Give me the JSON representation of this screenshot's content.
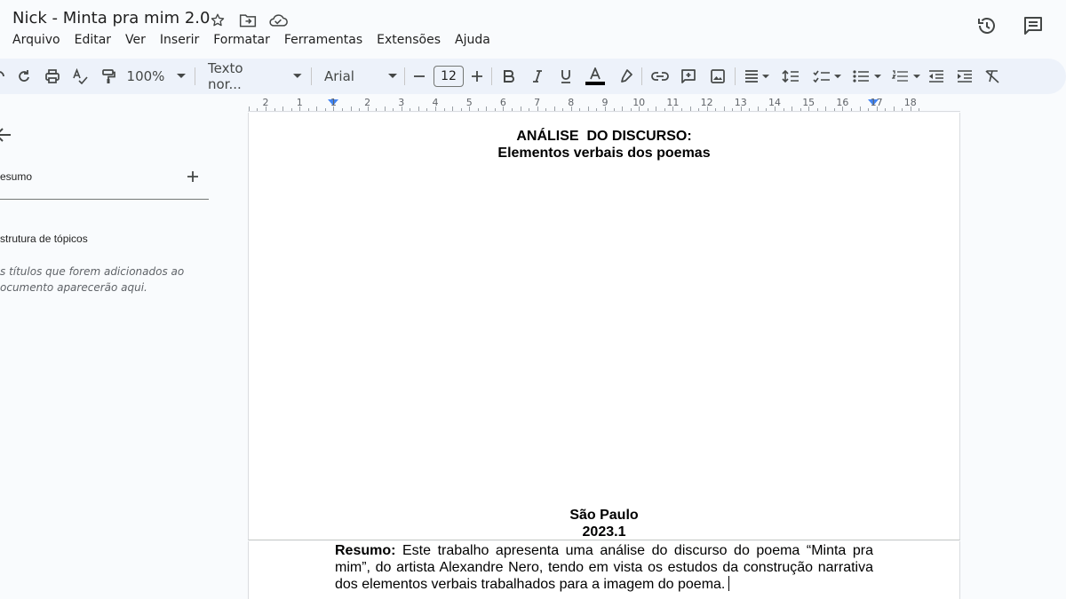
{
  "window": {
    "doc_title": "Nick - Minta pra mim 2.0"
  },
  "menu": [
    "Arquivo",
    "Editar",
    "Ver",
    "Inserir",
    "Formatar",
    "Ferramentas",
    "Extensões",
    "Ajuda"
  ],
  "toolbar": {
    "zoom": "100%",
    "style": "Texto nor...",
    "font": "Arial",
    "font_size": "12"
  },
  "ruler": {
    "numbers": [
      "2",
      "1",
      "1",
      "2",
      "3",
      "4",
      "5",
      "6",
      "7",
      "8",
      "9",
      "10",
      "11",
      "12",
      "13",
      "14",
      "15",
      "16",
      "17",
      "18"
    ]
  },
  "sidebar": {
    "summary_label": "esumo",
    "outline_label": "strutura de tópicos",
    "outline_hint": "s títulos que forem adicionados ao ocumento aparecerão aqui."
  },
  "document": {
    "heading1": "ANÁLISE  DO DISCURSO:",
    "heading2": "Elementos verbais dos poemas",
    "city": "São Paulo",
    "year": "2023.1",
    "abstract_label": "Resumo:",
    "abstract_text": " Este trabalho apresenta uma análise do discurso do poema “Minta pra mim”, do artista Alexandre Nero, tendo em vista os estudos da construção narrativa dos elementos verbais trabalhados para a imagem do poema."
  },
  "colors": {
    "accent": "#4285f4",
    "toolbar_bg": "#edf2fa",
    "page_bg": "#f9fbfd"
  }
}
